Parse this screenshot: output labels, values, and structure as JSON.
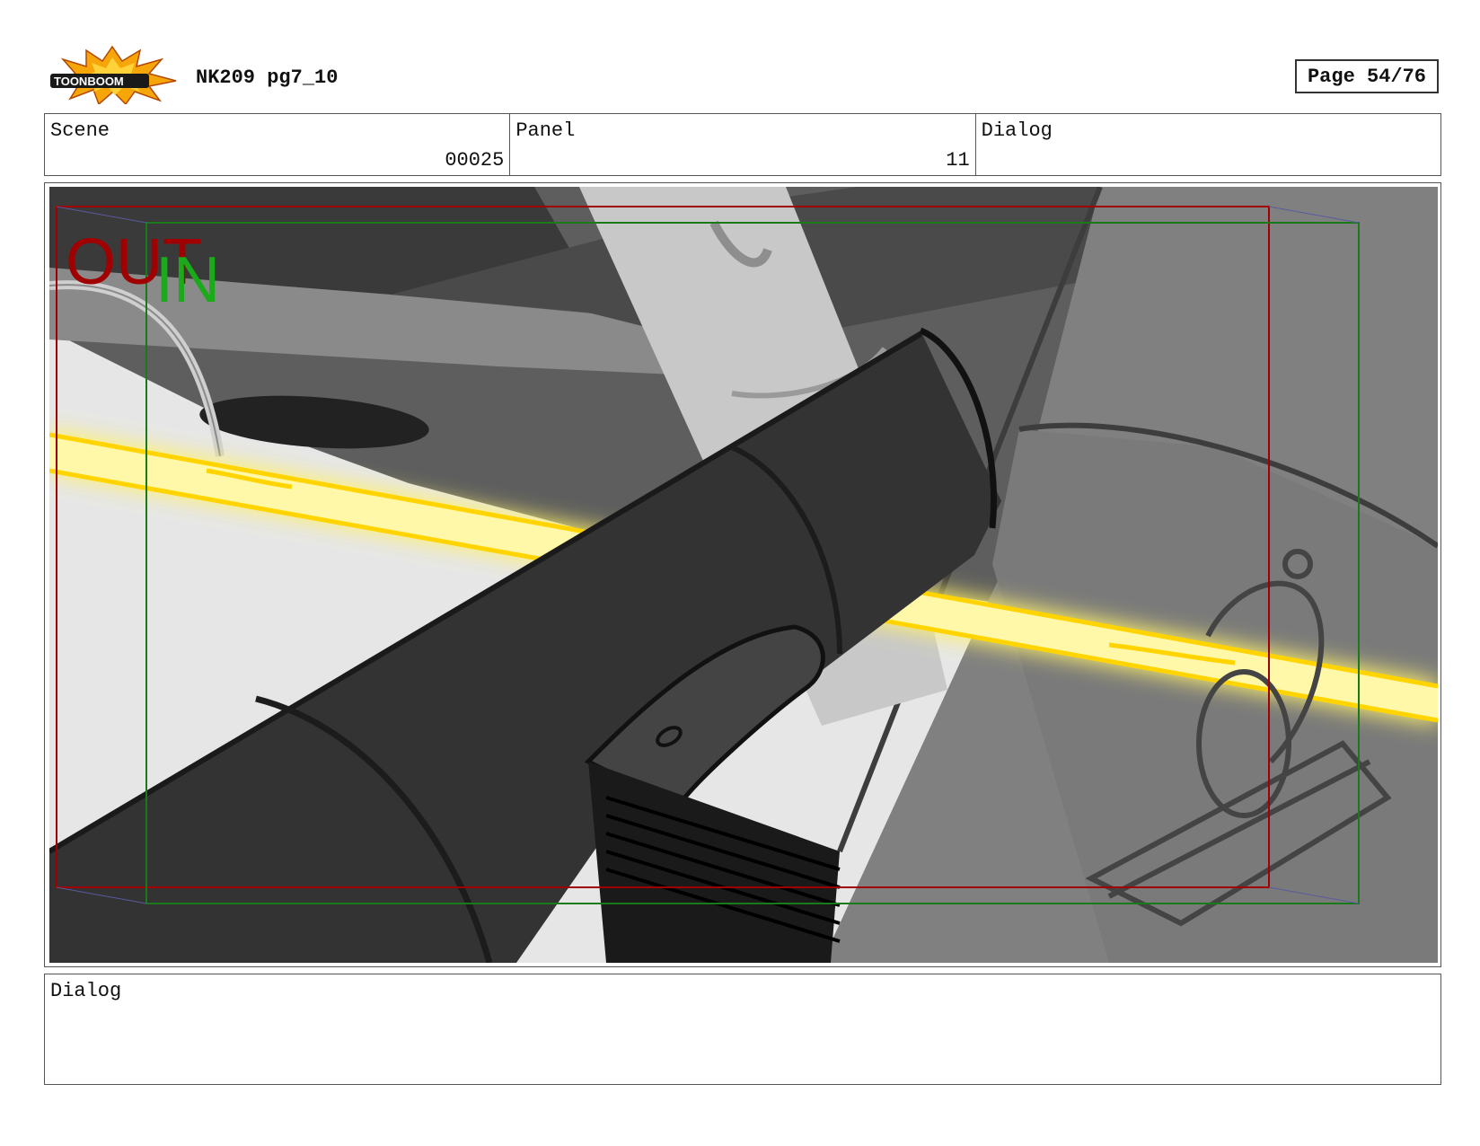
{
  "header": {
    "logo_text": "TOONBOOM",
    "title": "NK209 pg7_10",
    "page": "Page 54/76"
  },
  "info": {
    "scene_label": "Scene",
    "scene_value": "00025",
    "panel_label": "Panel",
    "panel_value": "11",
    "dialog_label": "Dialog"
  },
  "frame": {
    "out_label": "OUT",
    "in_label": "IN"
  },
  "dialog": {
    "label": "Dialog"
  },
  "colors": {
    "out_frame": "#a00000",
    "in_frame": "#1a8a1a",
    "beam": "#ffe94a",
    "logo_burst": "#f5a000"
  }
}
